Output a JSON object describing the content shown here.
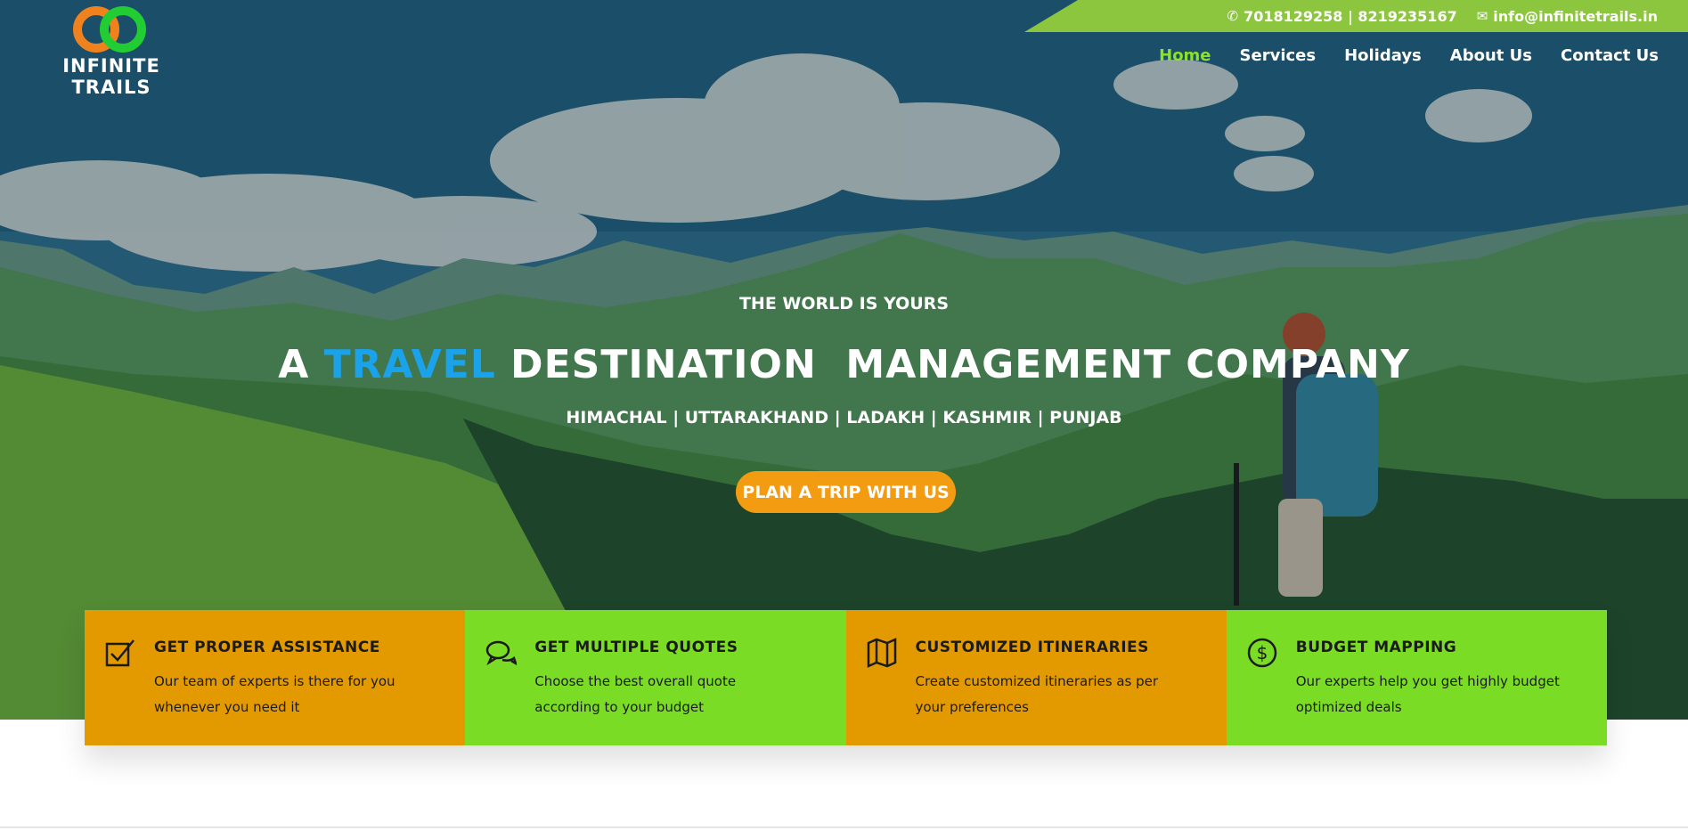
{
  "contact": {
    "phones": "7018129258 | 8219235167",
    "email": "info@infinitetrails.in",
    "phone_icon": "phone-icon",
    "email_icon": "envelope-icon"
  },
  "logo": {
    "text": "INFINITE TRAILS",
    "ring_colors": [
      "#f0821e",
      "#22cc33"
    ]
  },
  "nav": {
    "items": [
      {
        "label": "Home",
        "active": true
      },
      {
        "label": "Services",
        "active": false
      },
      {
        "label": "Holidays",
        "active": false
      },
      {
        "label": "About Us",
        "active": false
      },
      {
        "label": "Contact Us",
        "active": false
      }
    ]
  },
  "hero": {
    "eyebrow": "THE WORLD IS YOURS",
    "headline_before": "A ",
    "headline_accent": "TRAVEL",
    "headline_after": " DESTINATION  MANAGEMENT COMPANY",
    "regions": "HIMACHAL | UTTARAKHAND | LADAKH | KASHMIR | PUNJAB",
    "cta_label": "PLAN A TRIP WITH US"
  },
  "features": [
    {
      "icon": "checkbox-icon",
      "title": "GET PROPER ASSISTANCE",
      "text": "Our team of experts is there for you whenever you need it"
    },
    {
      "icon": "chat-bubbles-icon",
      "title": "GET MULTIPLE QUOTES",
      "text": "Choose the best overall quote according to your budget"
    },
    {
      "icon": "map-icon",
      "title": "CUSTOMIZED ITINERARIES",
      "text": "Create customized itineraries as per your preferences"
    },
    {
      "icon": "dollar-circle-icon",
      "title": "BUDGET MAPPING",
      "text": "Our experts help you get highly budget optimized deals"
    }
  ],
  "colors": {
    "accent_green": "#8cc63f",
    "nav_active": "#8ee02b",
    "headline_accent": "#1aa3ea",
    "cta": "#f39c12",
    "feature_orange": "#e39a00",
    "feature_green": "#7adc24"
  }
}
